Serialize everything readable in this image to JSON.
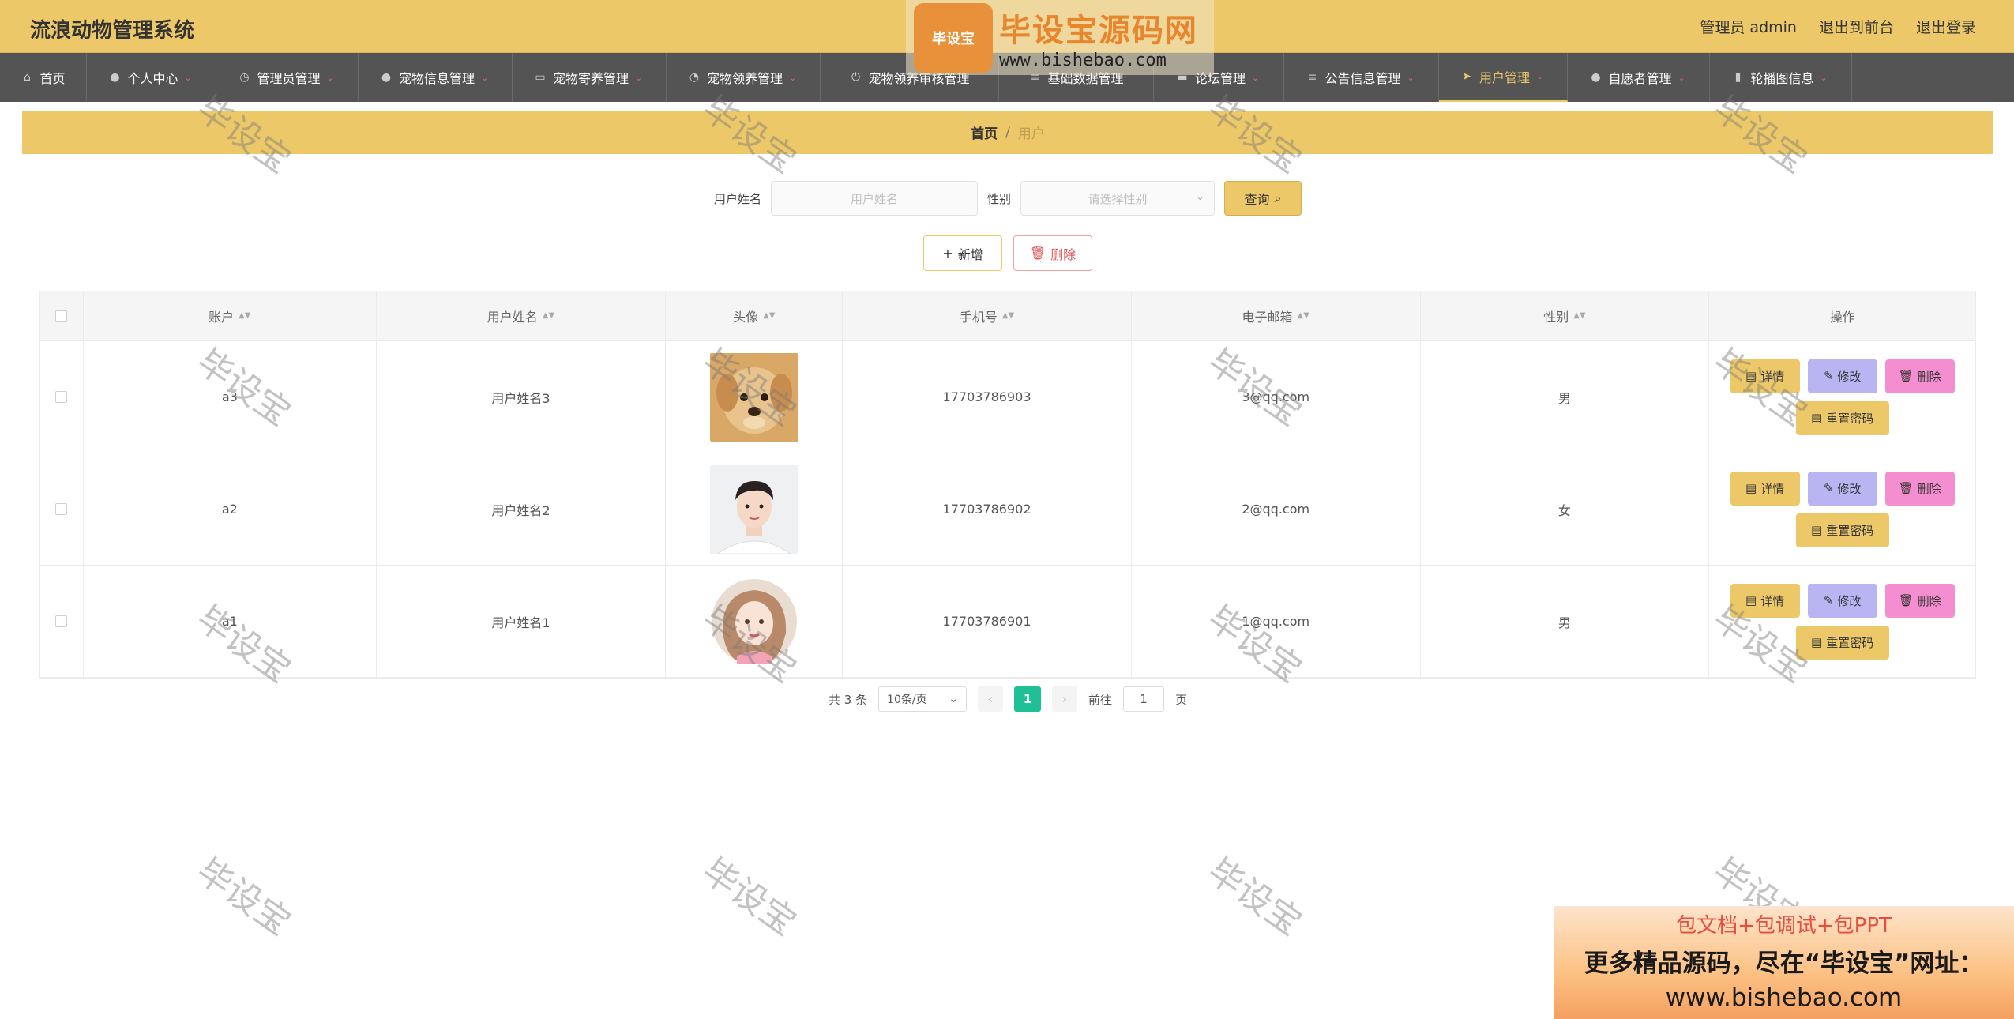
{
  "app_title": "流浪动物管理系统",
  "header": {
    "admin_label": "管理员 admin",
    "to_front": "退出到前台",
    "logout": "退出登录"
  },
  "nav": [
    {
      "label": "首页",
      "icon": "home-icon"
    },
    {
      "label": "个人中心",
      "icon": "user-icon"
    },
    {
      "label": "管理员管理",
      "icon": "clock-icon"
    },
    {
      "label": "宠物信息管理",
      "icon": "user-icon"
    },
    {
      "label": "宠物寄养管理",
      "icon": "briefcase-icon"
    },
    {
      "label": "宠物领养管理",
      "icon": "gauge-icon"
    },
    {
      "label": "宠物领养审核管理",
      "icon": "power-icon"
    },
    {
      "label": "基础数据管理",
      "icon": "list-icon"
    },
    {
      "label": "论坛管理",
      "icon": "chat-icon"
    },
    {
      "label": "公告信息管理",
      "icon": "list-icon"
    },
    {
      "label": "用户管理",
      "icon": "send-icon"
    },
    {
      "label": "自愿者管理",
      "icon": "location-icon"
    },
    {
      "label": "轮播图信息",
      "icon": "clipboard-icon"
    }
  ],
  "breadcrumb": {
    "home": "首页",
    "sep": "/",
    "current": "用户"
  },
  "search": {
    "name_label": "用户姓名",
    "name_placeholder": "用户姓名",
    "gender_label": "性别",
    "gender_placeholder": "请选择性别",
    "query_label": "查询"
  },
  "actions": {
    "add_label": "新增",
    "delete_label": "删除"
  },
  "table": {
    "headers": [
      "账户",
      "用户姓名",
      "头像",
      "手机号",
      "电子邮箱",
      "性别",
      "操作"
    ],
    "rows": [
      {
        "account": "a3",
        "name": "用户姓名3",
        "phone": "17703786903",
        "email": "3@qq.com",
        "gender": "男",
        "avatar": "puppy"
      },
      {
        "account": "a2",
        "name": "用户姓名2",
        "phone": "17703786902",
        "email": "2@qq.com",
        "gender": "女",
        "avatar": "man"
      },
      {
        "account": "a1",
        "name": "用户姓名1",
        "phone": "17703786901",
        "email": "1@qq.com",
        "gender": "男",
        "avatar": "girl"
      }
    ],
    "op_labels": {
      "detail": "详情",
      "edit": "修改",
      "delete": "删除",
      "reset": "重置密码"
    }
  },
  "pager": {
    "total": "共 3 条",
    "page_size": "10条/页",
    "current": "1",
    "goto": "前往",
    "goto_value": "1",
    "page_unit": "页"
  },
  "watermark": {
    "logo_text": "毕设宝",
    "logo_main": "毕设宝源码网",
    "logo_url": "www.bishebao.com",
    "mark": "毕设宝"
  },
  "promo": {
    "line1": "包文档+包调试+包PPT",
    "line2": "更多精品源码，尽在“毕设宝”网址：",
    "line3": "www.bishebao.com"
  }
}
